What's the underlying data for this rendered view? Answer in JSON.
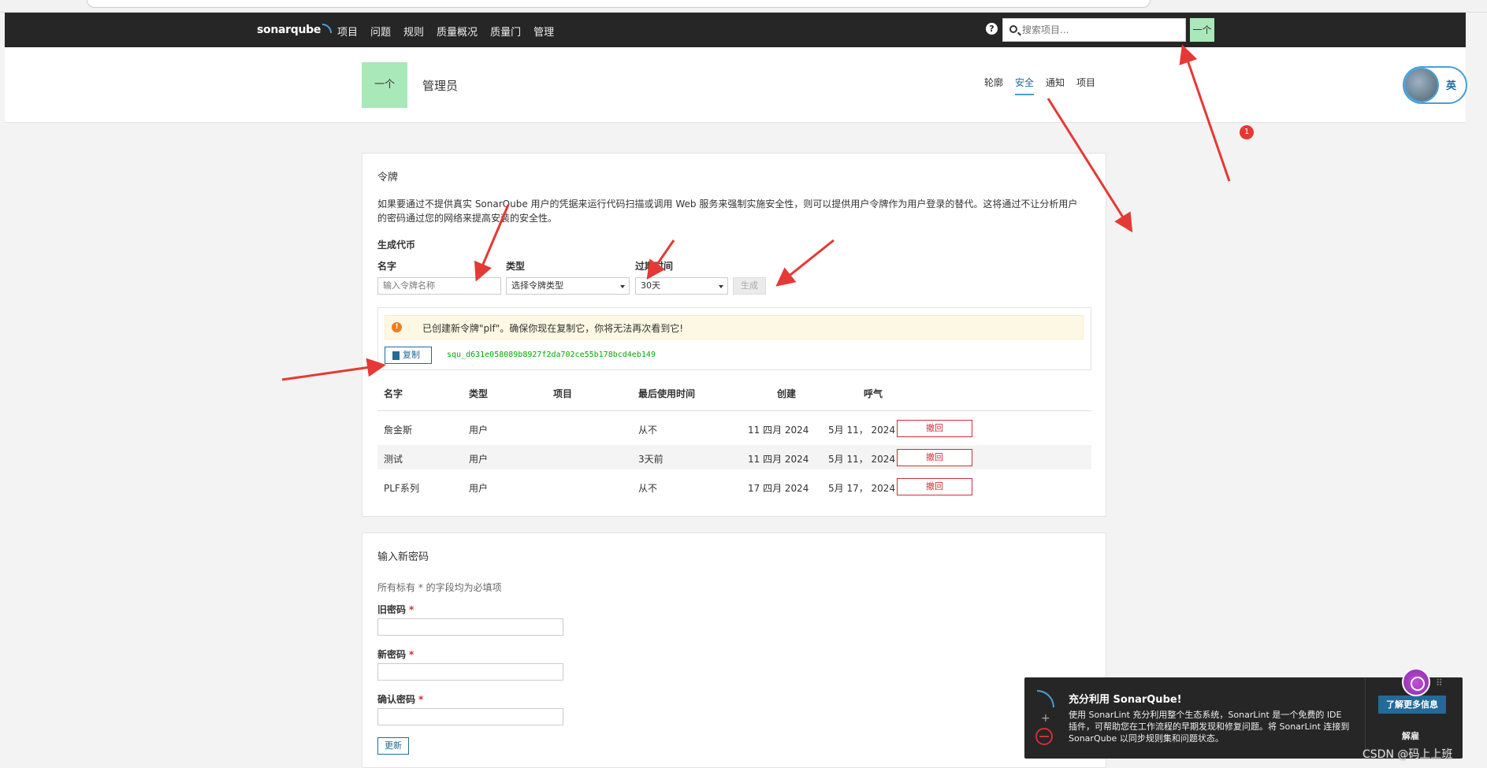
{
  "nav": {
    "logo": "sonarqube",
    "items": [
      "项目",
      "问题",
      "规则",
      "质量概况",
      "质量门",
      "管理"
    ],
    "help": "?",
    "search_placeholder": "搜索项目...",
    "user_initial": "一个"
  },
  "account": {
    "avatar_text": "一个",
    "name": "管理员",
    "tabs": [
      "轮廓",
      "安全",
      "通知",
      "项目"
    ],
    "active_tab": "安全"
  },
  "overlay": {
    "lang": "英",
    "badge": "1"
  },
  "tokens": {
    "title": "令牌",
    "intro": "如果要通过不提供真实 SonarQube 用户的凭据来运行代码扫描或调用 Web 服务来强制实施安全性，则可以提供用户令牌作为用户登录的替代。这将通过不让分析用户的密码通过您的网络来提高安装的安全性。",
    "generate_title": "生成代币",
    "name_label": "名字",
    "name_placeholder": "输入令牌名称",
    "type_label": "类型",
    "type_value": "选择令牌类型",
    "expiry_label": "过期时间",
    "expiry_value": "30天",
    "generate_button": "生成",
    "created_message": "已创建新令牌\"plf\"。确保你现在复制它，你将无法再次看到它!",
    "copy_button": "复制",
    "token_value": "squ_d631e058089b8927f2da702ce55b178bcd4eb149",
    "columns": [
      "名字",
      "类型",
      "项目",
      "最后使用时间",
      "创建",
      "呼气"
    ],
    "rows": [
      {
        "name": "詹金斯",
        "type": "用户",
        "project": "",
        "last_used": "从不",
        "created": "11 四月 2024",
        "expires": "5月 11， 2024",
        "action": "撤回"
      },
      {
        "name": "测试",
        "type": "用户",
        "project": "",
        "last_used": "3天前",
        "created": "11 四月 2024",
        "expires": "5月 11， 2024",
        "action": "撤回"
      },
      {
        "name": "PLF系列",
        "type": "用户",
        "project": "",
        "last_used": "从不",
        "created": "17 四月 2024",
        "expires": "5月 17， 2024",
        "action": "撤回"
      }
    ]
  },
  "password": {
    "title": "输入新密码",
    "required_note": "所有标有 * 的字段均为必填项",
    "old_label": "旧密码",
    "new_label": "新密码",
    "confirm_label": "确认密码",
    "required_mark": "*",
    "update_button": "更新"
  },
  "toast": {
    "title": "充分利用 SonarQube!",
    "body": "使用 SonarLint 充分利用整个生态系统，SonarLint 是一个免费的 IDE 插件，可帮助您在工作流程的早期发现和修复问题。将 SonarLint 连接到 SonarQube 以同步规则集和问题状态。",
    "learn_more": "了解更多信息",
    "dismiss": "解雇"
  },
  "watermark": "CSDN @码上上班"
}
